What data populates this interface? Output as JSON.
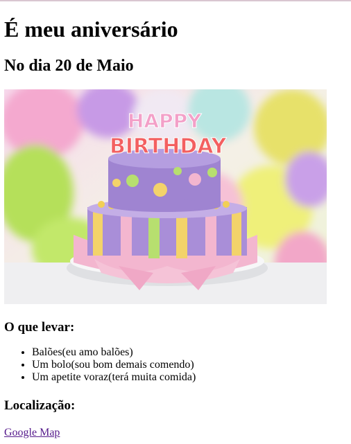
{
  "page": {
    "title": "É meu aniversário",
    "subtitle": "No dia 20 de Maio",
    "image_text_top": "HAPPY",
    "image_text_bottom": "BIRTHDAY",
    "bring_heading": "O que levar:",
    "bring_items": [
      "Balões(eu amo balões)",
      "Um bolo(sou bom demais comendo)",
      "Um apetite voraz(terá muita comida)"
    ],
    "location_heading": "Localização:",
    "map_link": "Google Map"
  },
  "colors": {
    "link_visited": "#551a8b",
    "cake_purple": "#a98ed8",
    "cake_pink": "#f3b6cf"
  }
}
